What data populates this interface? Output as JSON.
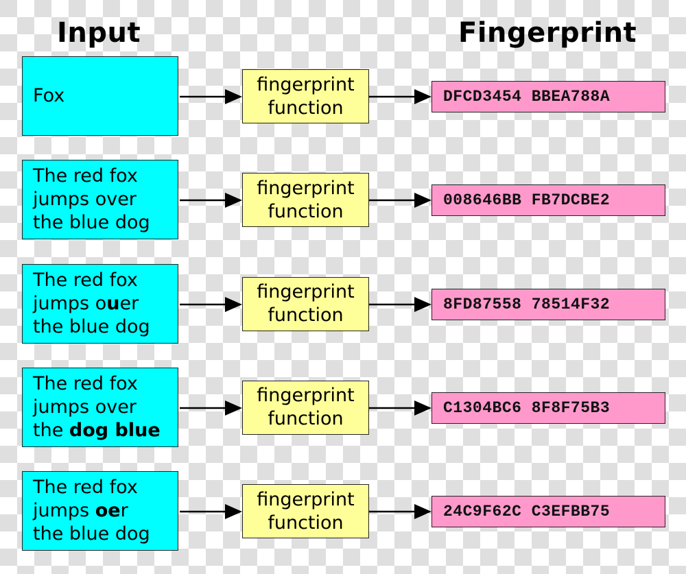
{
  "headings": {
    "input": "Input",
    "fingerprint": "Fingerprint"
  },
  "function_label": [
    "fingerprint",
    "function"
  ],
  "colors": {
    "input_box": "#00ffff",
    "function_box": "#ffff99",
    "fingerprint_box": "#ff99cc",
    "checker_light": "#ffffff",
    "checker_dark": "#dfdfdf"
  },
  "rows": [
    {
      "input_lines": [
        [
          {
            "t": "Fox",
            "b": false
          }
        ]
      ],
      "function_lines": [
        "fingerprint",
        "function"
      ],
      "fingerprint": "DFCD3454 BBEA788A"
    },
    {
      "input_lines": [
        [
          {
            "t": "The red fox",
            "b": false
          }
        ],
        [
          {
            "t": "jumps over",
            "b": false
          }
        ],
        [
          {
            "t": "the blue dog",
            "b": false
          }
        ]
      ],
      "function_lines": [
        "fingerprint",
        "function"
      ],
      "fingerprint": "008646BB FB7DCBE2"
    },
    {
      "input_lines": [
        [
          {
            "t": "The red fox",
            "b": false
          }
        ],
        [
          {
            "t": "jumps o",
            "b": false
          },
          {
            "t": "u",
            "b": true
          },
          {
            "t": "er",
            "b": false
          }
        ],
        [
          {
            "t": "the blue dog",
            "b": false
          }
        ]
      ],
      "function_lines": [
        "fingerprint",
        "function"
      ],
      "fingerprint": "8FD87558 78514F32"
    },
    {
      "input_lines": [
        [
          {
            "t": "The red fox",
            "b": false
          }
        ],
        [
          {
            "t": "jumps over",
            "b": false
          }
        ],
        [
          {
            "t": "the ",
            "b": false
          },
          {
            "t": "dog blue",
            "b": true
          }
        ]
      ],
      "function_lines": [
        "fingerprint",
        "function"
      ],
      "fingerprint": "C1304BC6 8F8F75B3"
    },
    {
      "input_lines": [
        [
          {
            "t": "The red fox",
            "b": false
          }
        ],
        [
          {
            "t": "jumps ",
            "b": false
          },
          {
            "t": "oe",
            "b": true
          },
          {
            "t": "r",
            "b": false
          }
        ],
        [
          {
            "t": "the blue dog",
            "b": false
          }
        ]
      ],
      "function_lines": [
        "fingerprint",
        "function"
      ],
      "fingerprint": "24C9F62C C3EFBB75"
    }
  ]
}
